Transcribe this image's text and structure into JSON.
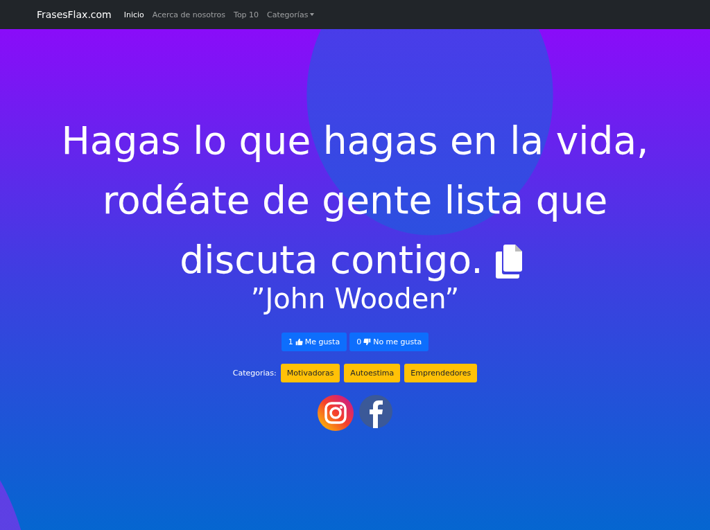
{
  "navbar": {
    "brand": "FrasesFlax.com",
    "links": [
      {
        "label": "Inicio",
        "selected": true,
        "kind": "link"
      },
      {
        "label": "Acerca de nosotros",
        "selected": false,
        "kind": "link"
      },
      {
        "label": "Top 10",
        "selected": false,
        "kind": "link"
      },
      {
        "label": "Categorías",
        "selected": false,
        "kind": "dropdown"
      }
    ]
  },
  "quote": {
    "lines": [
      "Hagas lo que hagas en la vida,",
      "rodéate de gente lista que",
      "discuta contigo."
    ],
    "author": "”John Wooden”"
  },
  "votes": [
    {
      "count": "1",
      "label": "Me gusta",
      "kind": "like"
    },
    {
      "count": "0",
      "label": "No me gusta",
      "kind": "dislike"
    }
  ],
  "categories": {
    "label": "Categorias:",
    "tags": [
      "Motivadoras",
      "Autoestima",
      "Emprendedores"
    ]
  },
  "social": [
    {
      "kind": "instagram"
    },
    {
      "kind": "facebook"
    }
  ]
}
